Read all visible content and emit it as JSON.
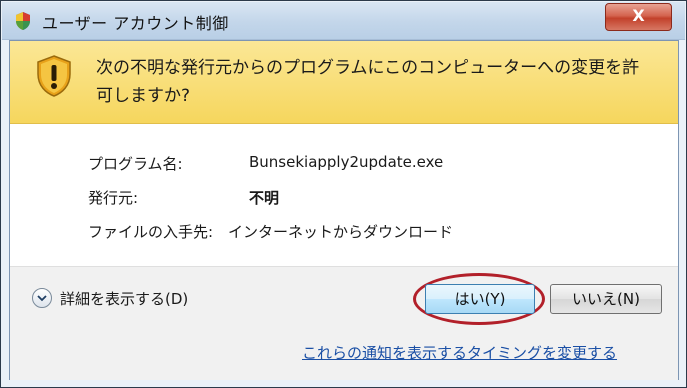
{
  "window": {
    "title": "ユーザー アカウント制御",
    "close_label": "X"
  },
  "banner": {
    "line1": "次の不明な発行元からのプログラムにこのコンピューターへの変更を許",
    "line2": "可しますか?"
  },
  "details": {
    "program_label": "プログラム名:",
    "program_value": "Bunsekiapply2update.exe",
    "publisher_label": "発行元:",
    "publisher_value": "不明",
    "origin_label": "ファイルの入手先:",
    "origin_value": "インターネットからダウンロード"
  },
  "footer": {
    "show_details": "詳細を表示する(D)",
    "yes_button": "はい(Y)",
    "no_button": "いいえ(N)",
    "change_link": "これらの通知を表示するタイミングを変更する"
  },
  "colors": {
    "banner": "#f6d65d",
    "link": "#1a4fa5",
    "highlight_ring": "#b2202a",
    "close_button": "#c2412b"
  },
  "icons": [
    "uac-shield-icon",
    "warning-shield-icon",
    "chevron-down-icon",
    "close-icon"
  ]
}
